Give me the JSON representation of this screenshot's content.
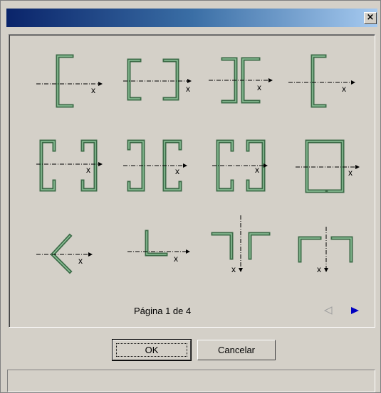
{
  "window": {
    "close_label": "×"
  },
  "sections": [
    {
      "id": "c-shape-left",
      "axis_label": "x"
    },
    {
      "id": "c-pair-facing",
      "axis_label": "x"
    },
    {
      "id": "c-pair-back",
      "axis_label": "x"
    },
    {
      "id": "c-shape-right",
      "axis_label": "x"
    },
    {
      "id": "lipped-c-pair-facing",
      "axis_label": "x"
    },
    {
      "id": "lipped-c-pair-back",
      "axis_label": "x"
    },
    {
      "id": "lipped-c-pair-facing-2",
      "axis_label": "x"
    },
    {
      "id": "closed-box",
      "axis_label": "x"
    },
    {
      "id": "angle-v",
      "axis_label": "x"
    },
    {
      "id": "angle-l",
      "axis_label": "x"
    },
    {
      "id": "double-angle-t",
      "axis_label": "x"
    },
    {
      "id": "hat-section",
      "axis_label": "x"
    }
  ],
  "pager": {
    "text": "Página 1 de 4",
    "prev_icon": "triangle-left-icon",
    "next_icon": "triangle-right-icon",
    "next_color": "#0000c0",
    "prev_color": "#a0a0a0"
  },
  "buttons": {
    "ok": "OK",
    "cancel": "Cancelar"
  }
}
